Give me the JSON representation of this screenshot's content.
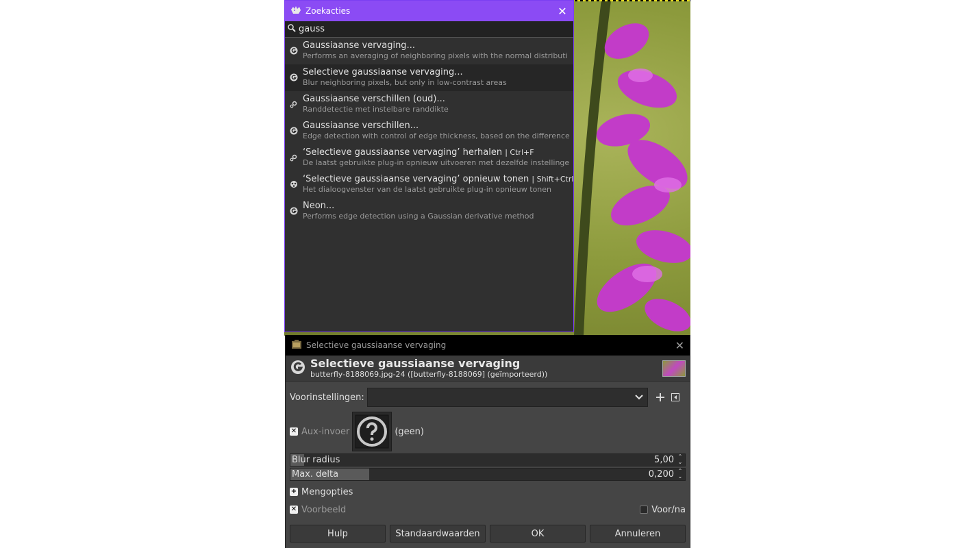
{
  "search_popup": {
    "title": "Zoekacties",
    "query": "gauss",
    "results": [
      {
        "title": "Gaussiaanse vervaging...",
        "shortcut": "",
        "desc": "Performs an averaging of neighboring pixels with the normal distributi",
        "icon": "gegl-icon"
      },
      {
        "title": "Selectieve gaussiaanse vervaging...",
        "shortcut": "",
        "desc": "Blur neighboring pixels, but only in low-contrast areas",
        "icon": "gegl-icon"
      },
      {
        "title": "Gaussiaanse verschillen (oud)...",
        "shortcut": "",
        "desc": "Randdetectie met instelbare randdikte",
        "icon": "plugin-gear-icon"
      },
      {
        "title": "Gaussiaanse verschillen...",
        "shortcut": "",
        "desc": "Edge detection with control of edge thickness, based on the difference",
        "icon": "gegl-icon"
      },
      {
        "title": "‘Selectieve gaussiaanse vervaging’ herhalen",
        "shortcut": "| Ctrl+F",
        "desc": "De laatst gebruikte plug-in opnieuw uitvoeren met dezelfde instellinge",
        "icon": "plugin-gear-icon"
      },
      {
        "title": "‘Selectieve gaussiaanse vervaging’ opnieuw tonen",
        "shortcut": "| Shift+Ctrl",
        "desc": "Het dialoogvenster van de laatst gebruikte plug-in opnieuw tonen",
        "icon": "reshow-icon"
      },
      {
        "title": "Neon...",
        "shortcut": "",
        "desc": "Performs edge detection using a Gaussian derivative method",
        "icon": "gegl-icon"
      }
    ]
  },
  "dialog": {
    "window_title": "Selectieve gaussiaanse vervaging",
    "header_title": "Selectieve gaussiaanse vervaging",
    "header_subtitle": "butterfly-8188069.jpg-24 ([butterfly-8188069] (geïmporteerd))",
    "presets_label": "Voorinstellingen:",
    "presets_value": "",
    "aux_label": "Aux-invoer",
    "aux_value": "(geen)",
    "blur_radius": {
      "label": "Blur radius",
      "value": "5,00",
      "fraction": 0.035
    },
    "max_delta": {
      "label": "Max. delta",
      "value": "0,200",
      "fraction": 0.2
    },
    "blend_label": "Mengopties",
    "preview_label": "Voorbeeld",
    "split_label": "Voor/na",
    "buttons": {
      "help": "Hulp",
      "reset": "Standaardwaarden",
      "ok": "OK",
      "cancel": "Annuleren"
    }
  },
  "colors": {
    "accent": "#8b4bf4",
    "dialog_bg": "#454545",
    "popup_bg": "#303030"
  }
}
